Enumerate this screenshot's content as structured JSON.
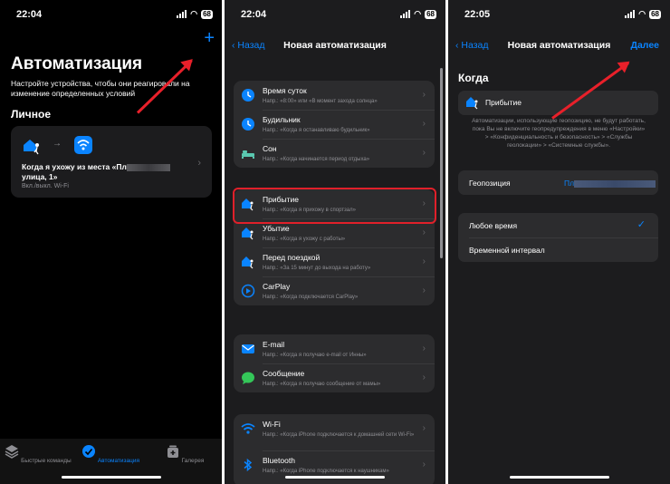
{
  "colors": {
    "accent": "#0a84ff",
    "highlight": "#e0202a"
  },
  "screen1": {
    "status": {
      "time": "22:04",
      "battery": "68"
    },
    "title": "Автоматизация",
    "subtitle": "Настройте устройства, чтобы они реагировали на изменение определенных условий",
    "section": "Личное",
    "card": {
      "title_prefix": "Когда я ухожу из места «Пл",
      "title_suffix": "улица, 1»",
      "subtitle": "Вкл./выкл. Wi-Fi"
    },
    "tabs": [
      {
        "label": "Быстрые команды",
        "icon": "layers-icon"
      },
      {
        "label": "Автоматизация",
        "icon": "clock-check-icon"
      },
      {
        "label": "Галерея",
        "icon": "gallery-plus-icon"
      }
    ]
  },
  "screen2": {
    "status": {
      "time": "22:04",
      "battery": "68"
    },
    "nav": {
      "back": "Назад",
      "title": "Новая автоматизация"
    },
    "groups": [
      [
        {
          "title": "Время суток",
          "subtitle": "Напр.: «8:00» или «В момент захода солнца»",
          "icon": "clock-icon"
        },
        {
          "title": "Будильник",
          "subtitle": "Напр.: «Когда я останавливаю будильник»",
          "icon": "alarm-icon"
        },
        {
          "title": "Сон",
          "subtitle": "Напр.: «Когда начинается период отдыха»",
          "icon": "bed-icon"
        }
      ],
      [
        {
          "title": "Прибытие",
          "subtitle": "Напр.: «Когда я прихожу в спортзал»",
          "icon": "arrive-icon"
        },
        {
          "title": "Убытие",
          "subtitle": "Напр.: «Когда я ухожу с работы»",
          "icon": "leave-icon"
        },
        {
          "title": "Перед поездкой",
          "subtitle": "Напр.: «За 15 минут до выхода на работу»",
          "icon": "commute-icon"
        },
        {
          "title": "CarPlay",
          "subtitle": "Напр.: «Когда подключается CarPlay»",
          "icon": "carplay-icon"
        }
      ],
      [
        {
          "title": "E-mail",
          "subtitle": "Напр.: «Когда я получаю e-mail от Инны»",
          "icon": "mail-icon"
        },
        {
          "title": "Сообщение",
          "subtitle": "Напр.: «Когда я получаю сообщение от мамы»",
          "icon": "message-icon"
        }
      ],
      [
        {
          "title": "Wi-Fi",
          "subtitle": "Напр.: «Когда iPhone подключается к домашней сети Wi-Fi»",
          "icon": "wifi-icon"
        },
        {
          "title": "Bluetooth",
          "subtitle": "Напр.: «Когда iPhone подключается к наушникам»",
          "icon": "bluetooth-icon"
        }
      ]
    ]
  },
  "screen3": {
    "status": {
      "time": "22:05",
      "battery": "68"
    },
    "nav": {
      "back": "Назад",
      "title": "Новая автоматизация",
      "next": "Далее"
    },
    "heading": "Когда",
    "trigger": "Прибытие",
    "note": "Автоматизации, использующие геопозицию, не будут работать, пока Вы не включите геопредупреждения в меню «Настройки» > «Конфиденциальность и безопасность» > «Службы геолокации» > «Системные службы».",
    "location_label": "Геопозиция",
    "location_value": "Пл",
    "options": [
      {
        "label": "Любое время",
        "selected": true
      },
      {
        "label": "Временной интервал",
        "selected": false
      }
    ]
  }
}
